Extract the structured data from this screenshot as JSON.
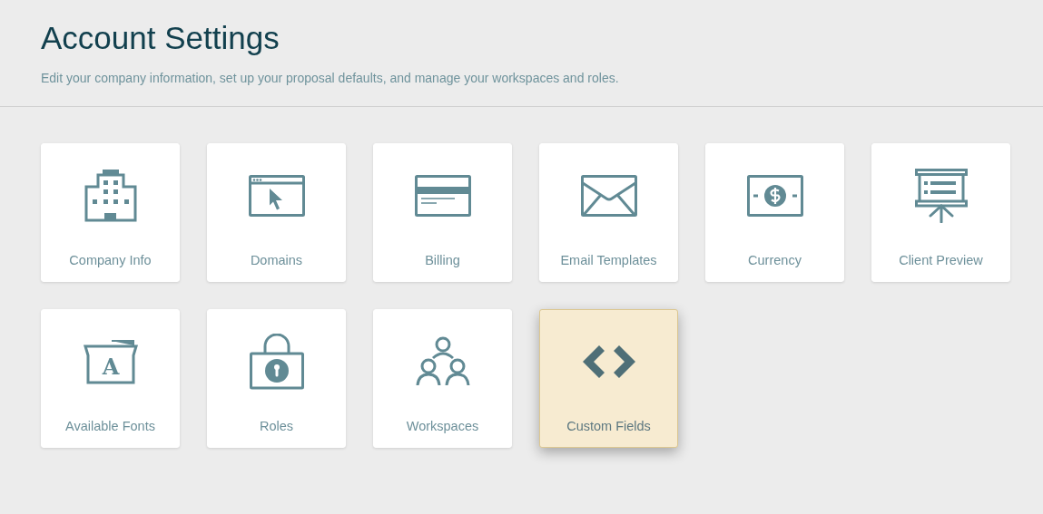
{
  "header": {
    "title": "Account Settings",
    "subtitle": "Edit your company information, set up your proposal defaults, and manage your workspaces and roles."
  },
  "tiles": [
    {
      "label": "Company Info",
      "selected": false
    },
    {
      "label": "Domains",
      "selected": false
    },
    {
      "label": "Billing",
      "selected": false
    },
    {
      "label": "Email Templates",
      "selected": false
    },
    {
      "label": "Currency",
      "selected": false
    },
    {
      "label": "Client Preview",
      "selected": false
    },
    {
      "label": "Available Fonts",
      "selected": false,
      "glyph": "A"
    },
    {
      "label": "Roles",
      "selected": false
    },
    {
      "label": "Workspaces",
      "selected": false
    },
    {
      "label": "Custom Fields",
      "selected": true
    }
  ]
}
